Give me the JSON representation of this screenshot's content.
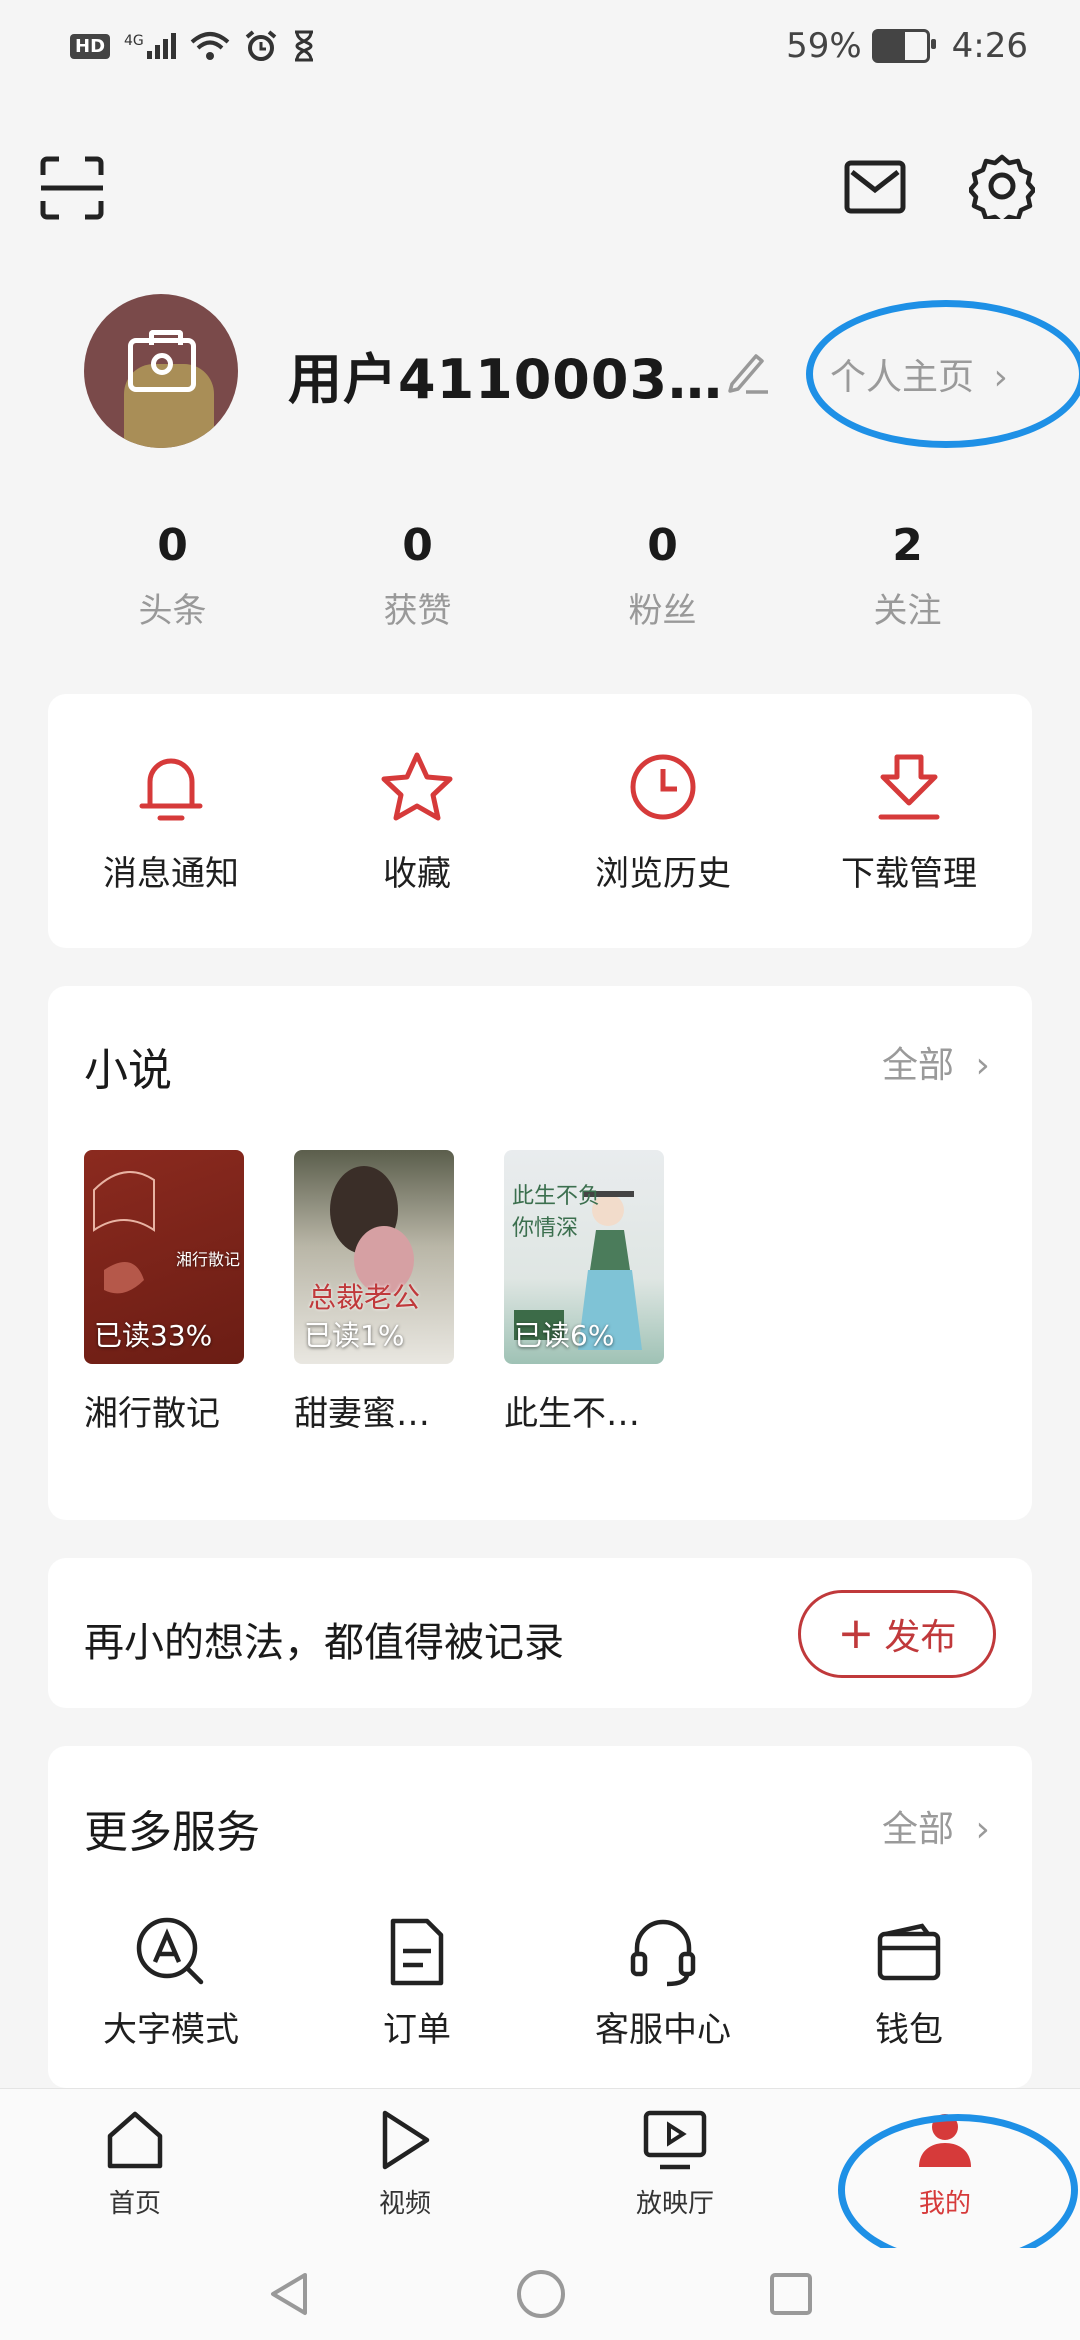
{
  "status_bar": {
    "hd": "HD",
    "network": "4G",
    "battery": "59%",
    "time": "4:26"
  },
  "profile": {
    "username": "用户4110003…",
    "profile_link": "个人主页"
  },
  "stats": [
    {
      "value": "0",
      "label": "头条"
    },
    {
      "value": "0",
      "label": "获赞"
    },
    {
      "value": "0",
      "label": "粉丝"
    },
    {
      "value": "2",
      "label": "关注"
    }
  ],
  "quick_actions": [
    {
      "label": "消息通知",
      "icon": "bell-icon"
    },
    {
      "label": "收藏",
      "icon": "star-icon"
    },
    {
      "label": "浏览历史",
      "icon": "clock-icon"
    },
    {
      "label": "下载管理",
      "icon": "download-icon"
    }
  ],
  "novels": {
    "title": "小说",
    "all_label": "全部",
    "books": [
      {
        "title": "湘行散记",
        "progress": "已读33%",
        "cover_text": "湘行散记"
      },
      {
        "title": "甜妻蜜…",
        "progress": "已读1%",
        "cover_text": "总裁老公"
      },
      {
        "title": "此生不…",
        "progress": "已读6%",
        "cover_text": "此生不负你情深"
      }
    ]
  },
  "post": {
    "prompt": "再小的想法，都值得被记录",
    "button": "发布"
  },
  "services": {
    "title": "更多服务",
    "all_label": "全部",
    "items": [
      {
        "label": "大字模式",
        "icon": "large-font-icon"
      },
      {
        "label": "订单",
        "icon": "order-icon"
      },
      {
        "label": "客服中心",
        "icon": "headset-icon"
      },
      {
        "label": "钱包",
        "icon": "wallet-icon"
      }
    ]
  },
  "tabs": [
    {
      "label": "首页",
      "icon": "home-icon"
    },
    {
      "label": "视频",
      "icon": "play-icon"
    },
    {
      "label": "放映厅",
      "icon": "tv-icon"
    },
    {
      "label": "我的",
      "icon": "user-icon",
      "active": true
    }
  ],
  "colors": {
    "accent": "#d63a3a",
    "highlight": "#1e90e6",
    "background": "#f5f5f5"
  }
}
